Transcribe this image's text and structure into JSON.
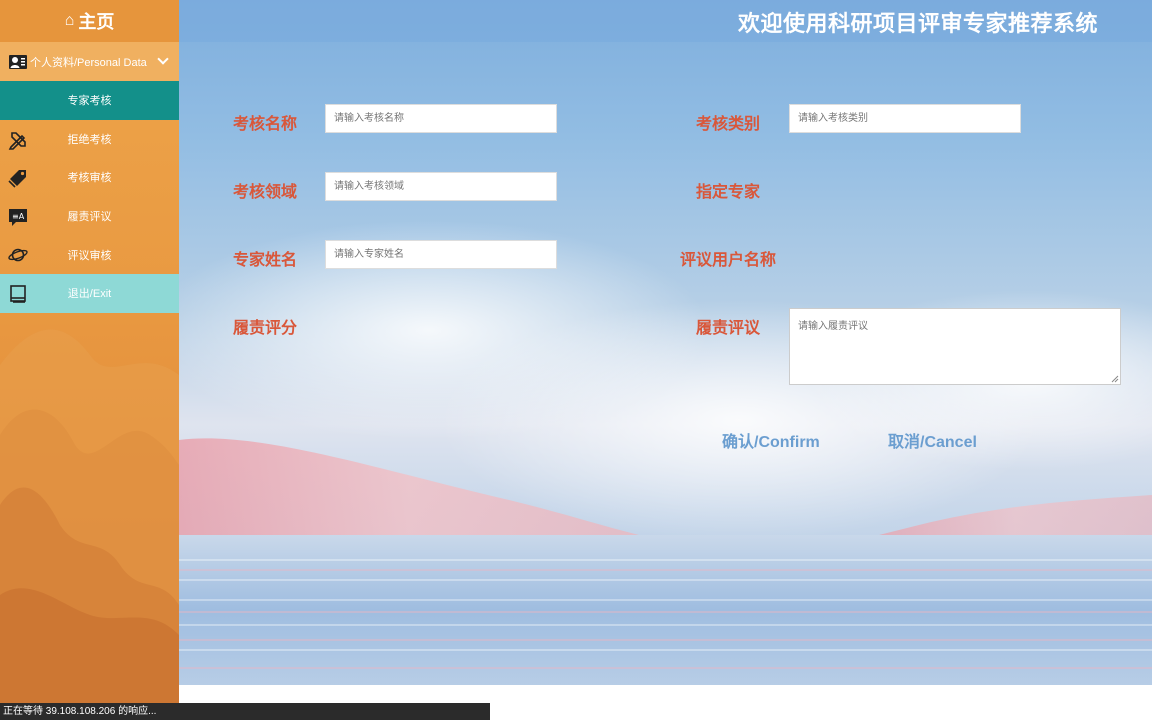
{
  "sidebar": {
    "home_label": "主页",
    "personal_label": "个人资料/Personal Data",
    "items": [
      {
        "label": "专家考核",
        "icon": "none"
      },
      {
        "label": "拒绝考核",
        "icon": "pencil-ruler-icon"
      },
      {
        "label": "考核审核",
        "icon": "tag-icon"
      },
      {
        "label": "履责评议",
        "icon": "translate-chat-icon"
      },
      {
        "label": "评议审核",
        "icon": "planet-icon"
      },
      {
        "label": "退出/Exit",
        "icon": "book-icon"
      }
    ]
  },
  "header": {
    "title": "欢迎使用科研项目评审专家推荐系统"
  },
  "form": {
    "assessment_name_label": "考核名称",
    "assessment_name_placeholder": "请输入考核名称",
    "assessment_type_label": "考核类别",
    "assessment_type_placeholder": "请输入考核类别",
    "assessment_field_label": "考核领域",
    "assessment_field_placeholder": "请输入考核领域",
    "assigned_expert_label": "指定专家",
    "expert_name_label": "专家姓名",
    "expert_name_placeholder": "请输入专家姓名",
    "review_username_label": "评议用户名称",
    "duty_score_label": "履责评分",
    "duty_review_label": "履责评议",
    "duty_review_placeholder": "请输入履责评议"
  },
  "actions": {
    "confirm_label": "确认/Confirm",
    "cancel_label": "取消/Cancel"
  },
  "status": {
    "text": "正在等待 39.108.108.206 的响应..."
  },
  "colors": {
    "sidebar_bg": "#e99a42",
    "active_item": "#13908a",
    "exit_item": "#8ed9d6",
    "label_red": "#d9573a",
    "button_blue": "#6b9ed0"
  }
}
